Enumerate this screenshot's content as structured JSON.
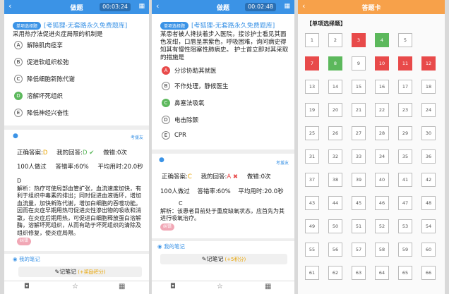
{
  "panel1": {
    "title": "做题",
    "timer": "00:03:24",
    "badge": "单项选择题",
    "brand": "[考狐狸-无套路永久免费题库]",
    "question": "采用热疗法促进炎症局限的机制是",
    "options": [
      {
        "letter": "A",
        "text": "解除肌肉痉挛"
      },
      {
        "letter": "B",
        "text": "促进软组织松弛"
      },
      {
        "letter": "C",
        "text": "降低细胞新陈代谢"
      },
      {
        "letter": "D",
        "text": "溶解坏死组织"
      },
      {
        "letter": "E",
        "text": "降低神经兴奋性"
      }
    ],
    "report_label": "考援友",
    "correct_answer_label": "正确答案:",
    "correct_answer": "D",
    "my_answer_label": "我的回答:",
    "my_answer": "D",
    "wrong_count": "做错:0次",
    "done_count": "100人做过",
    "accuracy": "答错率:60%",
    "avg_time": "平均用时:20.0秒",
    "analysis_letter": "D",
    "analysis": "解析：热疗可使局部血管扩张，血流速度加快，有利于组织中毒素的排出；同时促进血液循环，增加血流量，加快新陈代谢，增加白细胞的吞噬功能。因而在炎症早期用热可促进炎性渗出物的吸收和消散，在炎症后期用热，可促进白细胞释放蛋白溶解酶，溶解坏死组织，从而有助于坏死组织的清除及组织修复，使炎症局限。",
    "error_tag": "纠错",
    "note_title": "我的笔记",
    "note_button": "记笔记",
    "note_points": "(+奖励积分)"
  },
  "panel2": {
    "title": "做题",
    "timer": "00:02:48",
    "badge": "单项选择题",
    "brand": "[考狐狸-无套路永久免费题库]",
    "question": "某患者被人搀扶着步入医院，接诊护士看见其面色发绀，口唇呈黑紫色，呼吸困难，询问病史得知其有慢性阻塞性肺病史。 护士首立即对其采取的措施是",
    "options": [
      {
        "letter": "A",
        "text": "分诊协助其就医"
      },
      {
        "letter": "B",
        "text": "不作处理，静候医生"
      },
      {
        "letter": "C",
        "text": "鼻塞法吸氧"
      },
      {
        "letter": "D",
        "text": "电击除颤"
      },
      {
        "letter": "E",
        "text": "CPR"
      }
    ],
    "report_label": "考援友",
    "correct_answer_label": "正确答案:",
    "correct_answer": "C",
    "my_answer_label": "我的回答:",
    "my_answer": "A",
    "wrong_count": "做错:0次",
    "done_count": "100人做过",
    "accuracy": "答错率:60%",
    "avg_time": "平均用时:20.0秒",
    "analysis_letter": "C",
    "analysis": "解析：该患者目前处于重度缺氧状态，应首先为其进行吸氧治疗。",
    "error_tag": "纠错",
    "note_title": "我的笔记",
    "note_button": "记笔记",
    "note_points": "(+5积分)"
  },
  "panel3": {
    "title": "答题卡",
    "section": "【单项选择题】",
    "cells": [
      {
        "n": "1",
        "s": ""
      },
      {
        "n": "2",
        "s": ""
      },
      {
        "n": "3",
        "s": "red"
      },
      {
        "n": "4",
        "s": "green"
      },
      {
        "n": "5",
        "s": ""
      },
      {
        "n": "7",
        "s": "red"
      },
      {
        "n": "8",
        "s": "green"
      },
      {
        "n": "9",
        "s": ""
      },
      {
        "n": "10",
        "s": "red"
      },
      {
        "n": "11",
        "s": "red"
      },
      {
        "n": "12",
        "s": "red"
      },
      {
        "n": "13",
        "s": ""
      },
      {
        "n": "14",
        "s": ""
      },
      {
        "n": "15",
        "s": ""
      },
      {
        "n": "16",
        "s": ""
      },
      {
        "n": "17",
        "s": ""
      },
      {
        "n": "18",
        "s": ""
      },
      {
        "n": "19",
        "s": ""
      },
      {
        "n": "20",
        "s": ""
      },
      {
        "n": "21",
        "s": ""
      },
      {
        "n": "22",
        "s": ""
      },
      {
        "n": "23",
        "s": ""
      },
      {
        "n": "24",
        "s": ""
      },
      {
        "n": "25",
        "s": ""
      },
      {
        "n": "26",
        "s": ""
      },
      {
        "n": "27",
        "s": ""
      },
      {
        "n": "28",
        "s": ""
      },
      {
        "n": "29",
        "s": ""
      },
      {
        "n": "30",
        "s": ""
      },
      {
        "n": "31",
        "s": ""
      },
      {
        "n": "32",
        "s": ""
      },
      {
        "n": "33",
        "s": ""
      },
      {
        "n": "34",
        "s": ""
      },
      {
        "n": "35",
        "s": ""
      },
      {
        "n": "36",
        "s": ""
      },
      {
        "n": "37",
        "s": ""
      },
      {
        "n": "38",
        "s": ""
      },
      {
        "n": "39",
        "s": ""
      },
      {
        "n": "40",
        "s": ""
      },
      {
        "n": "41",
        "s": ""
      },
      {
        "n": "42",
        "s": ""
      },
      {
        "n": "43",
        "s": ""
      },
      {
        "n": "44",
        "s": ""
      },
      {
        "n": "45",
        "s": ""
      },
      {
        "n": "46",
        "s": ""
      },
      {
        "n": "47",
        "s": ""
      },
      {
        "n": "48",
        "s": ""
      },
      {
        "n": "49",
        "s": ""
      },
      {
        "n": "50",
        "s": ""
      },
      {
        "n": "51",
        "s": ""
      },
      {
        "n": "52",
        "s": ""
      },
      {
        "n": "53",
        "s": ""
      },
      {
        "n": "54",
        "s": ""
      },
      {
        "n": "55",
        "s": ""
      },
      {
        "n": "56",
        "s": ""
      },
      {
        "n": "57",
        "s": ""
      },
      {
        "n": "58",
        "s": ""
      },
      {
        "n": "59",
        "s": ""
      },
      {
        "n": "60",
        "s": ""
      },
      {
        "n": "61",
        "s": ""
      },
      {
        "n": "62",
        "s": ""
      },
      {
        "n": "63",
        "s": ""
      },
      {
        "n": "64",
        "s": ""
      },
      {
        "n": "65",
        "s": ""
      },
      {
        "n": "66",
        "s": ""
      }
    ]
  }
}
